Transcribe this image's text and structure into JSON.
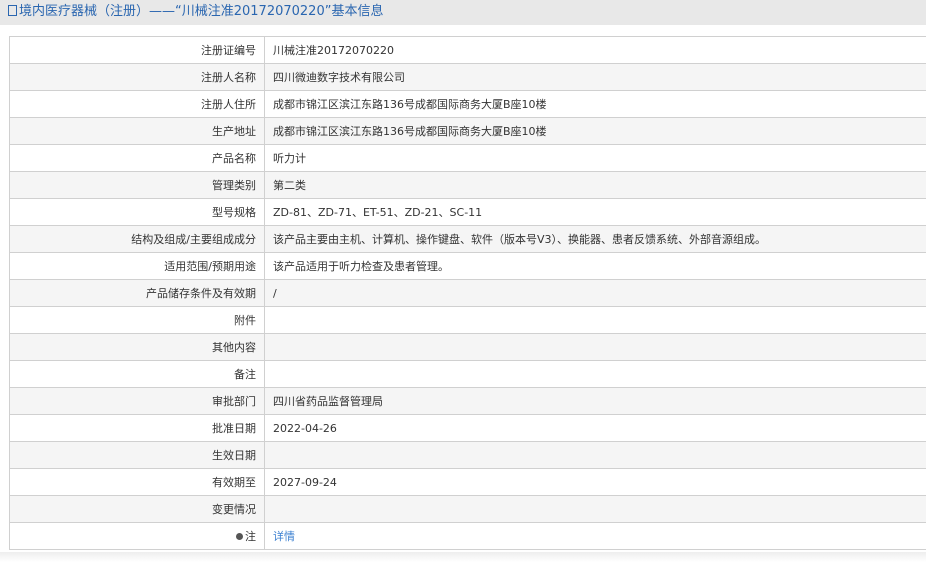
{
  "title": "境内医疗器械（注册）——“川械注准20172070220”基本信息",
  "rows": [
    [
      "注册证编号",
      "川械注准20172070220"
    ],
    [
      "注册人名称",
      "四川微迪数字技术有限公司"
    ],
    [
      "注册人住所",
      "成都市锦江区滨江东路136号成都国际商务大厦B座10楼"
    ],
    [
      "生产地址",
      "成都市锦江区滨江东路136号成都国际商务大厦B座10楼"
    ],
    [
      "产品名称",
      "听力计"
    ],
    [
      "管理类别",
      "第二类"
    ],
    [
      "型号规格",
      "ZD-81、ZD-71、ET-51、ZD-21、SC-11"
    ],
    [
      "结构及组成/主要组成成分",
      "该产品主要由主机、计算机、操作键盘、软件（版本号V3）、换能器、患者反馈系统、外部音源组成。"
    ],
    [
      "适用范围/预期用途",
      "该产品适用于听力检查及患者管理。"
    ],
    [
      "产品储存条件及有效期",
      "/"
    ],
    [
      "附件",
      ""
    ],
    [
      "其他内容",
      ""
    ],
    [
      "备注",
      ""
    ],
    [
      "审批部门",
      "四川省药品监督管理局"
    ],
    [
      "批准日期",
      "2022-04-26"
    ],
    [
      "生效日期",
      ""
    ],
    [
      "有效期至",
      "2027-09-24"
    ],
    [
      "变更情况",
      ""
    ]
  ],
  "note": {
    "label": "注",
    "link": "详情"
  }
}
